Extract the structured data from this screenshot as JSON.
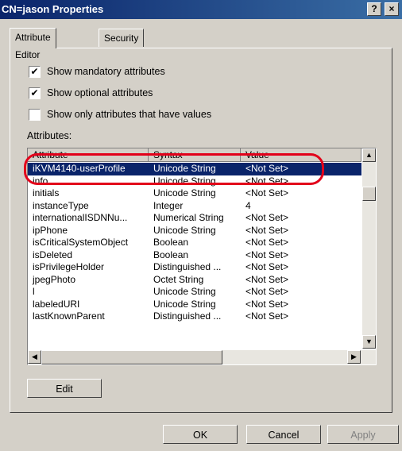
{
  "window": {
    "title": "CN=jason Properties",
    "help_button": "?",
    "close_button": "×"
  },
  "tabs": [
    {
      "label": "Attribute Editor"
    },
    {
      "label": "Security"
    }
  ],
  "options": {
    "mandatory": {
      "label": "Show mandatory attributes",
      "checked": true
    },
    "optional": {
      "label": "Show optional attributes",
      "checked": true
    },
    "only_values": {
      "label": "Show only attributes that have values",
      "checked": false
    }
  },
  "attributes_label": "Attributes:",
  "columns": {
    "attribute": "Attribute",
    "syntax": "Syntax",
    "value": "Value"
  },
  "rows": [
    {
      "attribute": "iKVM4140-userProfile",
      "syntax": "Unicode String",
      "value": "<Not Set>",
      "selected": true
    },
    {
      "attribute": "info",
      "syntax": "Unicode String",
      "value": "<Not Set>"
    },
    {
      "attribute": "initials",
      "syntax": "Unicode String",
      "value": "<Not Set>"
    },
    {
      "attribute": "instanceType",
      "syntax": "Integer",
      "value": "4"
    },
    {
      "attribute": "internationalISDNNu...",
      "syntax": "Numerical String",
      "value": "<Not Set>"
    },
    {
      "attribute": "ipPhone",
      "syntax": "Unicode String",
      "value": "<Not Set>"
    },
    {
      "attribute": "isCriticalSystemObject",
      "syntax": "Boolean",
      "value": "<Not Set>"
    },
    {
      "attribute": "isDeleted",
      "syntax": "Boolean",
      "value": "<Not Set>"
    },
    {
      "attribute": "isPrivilegeHolder",
      "syntax": "Distinguished ...",
      "value": "<Not Set>"
    },
    {
      "attribute": "jpegPhoto",
      "syntax": "Octet String",
      "value": "<Not Set>"
    },
    {
      "attribute": "l",
      "syntax": "Unicode String",
      "value": "<Not Set>"
    },
    {
      "attribute": "labeledURI",
      "syntax": "Unicode String",
      "value": "<Not Set>"
    },
    {
      "attribute": "lastKnownParent",
      "syntax": "Distinguished ...",
      "value": "<Not Set>"
    }
  ],
  "buttons": {
    "edit": "Edit",
    "ok": "OK",
    "cancel": "Cancel",
    "apply": "Apply"
  },
  "highlight_color": "#e2001a"
}
